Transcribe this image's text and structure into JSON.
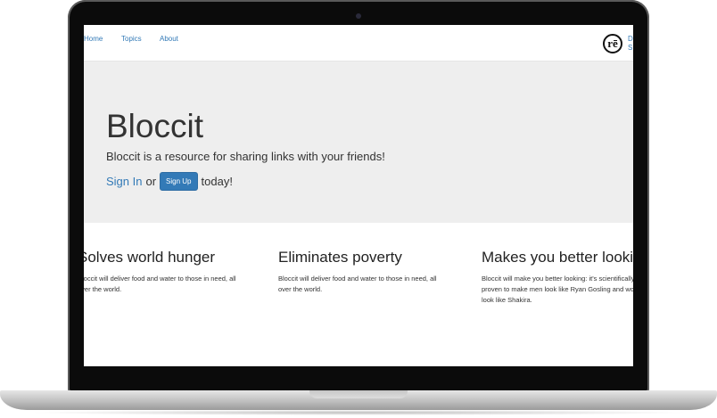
{
  "nav": {
    "home": "Home",
    "topics": "Topics",
    "about": "About",
    "logo_text": "rē",
    "edge_text_1": "D",
    "edge_text_2": "S"
  },
  "hero": {
    "title": "Bloccit",
    "subtitle": "Bloccit is a resource for sharing links with your friends!",
    "sign_in": "Sign In",
    "or": "or",
    "sign_up": "Sign Up",
    "today": "today!"
  },
  "features": [
    {
      "heading": "Solves world hunger",
      "lines": [
        "Bloccit will deliver food and water to those in need, all",
        "over the world."
      ]
    },
    {
      "heading": "Eliminates poverty",
      "lines": [
        "Bloccit will deliver food and water to those in need, all",
        "over the world."
      ]
    },
    {
      "heading": "Makes you better looking",
      "lines": [
        "Bloccit will make you better looking: it's scientifically",
        "proven to make men look like Ryan Gosling and women",
        "look like Shakira."
      ]
    }
  ],
  "colors": {
    "link": "#337ab7",
    "jumbotron_bg": "#eeeeee",
    "frame": "#0b0b0b"
  }
}
